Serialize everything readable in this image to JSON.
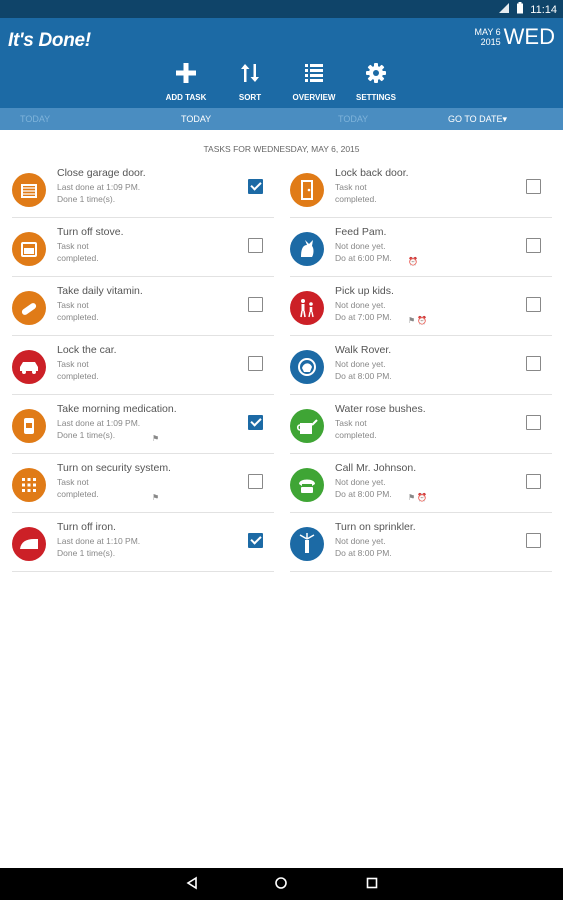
{
  "status_bar": {
    "time": "11:14"
  },
  "app": {
    "title": "It's Done!",
    "date_month_day": "MAY 6",
    "date_year": "2015",
    "weekday": "WED",
    "colors": {
      "primary": "#1c6aa5",
      "status": "#0f4469",
      "tabbar": "#4a8dc1"
    }
  },
  "toolbar": {
    "add_task": "ADD TASK",
    "sort": "SORT",
    "overview": "OVERVIEW",
    "settings": "SETTINGS"
  },
  "tabs": {
    "prev": "TODAY",
    "current": "TODAY",
    "next": "TODAY",
    "go_to_date": "GO TO DATE▾"
  },
  "subtitle": "TASKS FOR WEDNESDAY, MAY 6, 2015",
  "tasks_left": [
    {
      "title": "Close garage door.",
      "line1": "Last done at 1:09 PM.",
      "line2": "Done 1 time(s).",
      "checked": true,
      "icon": "garage-icon",
      "color": "#e07b17",
      "badge": ""
    },
    {
      "title": "Turn off stove.",
      "line1": "Task not",
      "line2": "completed.",
      "checked": false,
      "icon": "stove-icon",
      "color": "#e07b17",
      "badge": ""
    },
    {
      "title": "Take daily vitamin.",
      "line1": "Task not",
      "line2": "completed.",
      "checked": false,
      "icon": "vitamin-icon",
      "color": "#e07b17",
      "badge": ""
    },
    {
      "title": "Lock the car.",
      "line1": "Task not",
      "line2": "completed.",
      "checked": false,
      "icon": "car-icon",
      "color": "#cc2027",
      "badge": ""
    },
    {
      "title": "Take morning medication.",
      "line1": "Last done at 1:09 PM.",
      "line2": "Done 1 time(s).",
      "checked": true,
      "icon": "medication-icon",
      "color": "#e07b17",
      "badge": "⚑"
    },
    {
      "title": "Turn on security system.",
      "line1": "Task not",
      "line2": "completed.",
      "checked": false,
      "icon": "keypad-icon",
      "color": "#e07b17",
      "badge": "⚑"
    },
    {
      "title": "Turn off iron.",
      "line1": "Last done at 1:10 PM.",
      "line2": "Done 1 time(s).",
      "checked": true,
      "icon": "iron-icon",
      "color": "#cc2027",
      "badge": ""
    }
  ],
  "tasks_right": [
    {
      "title": "Lock back door.",
      "line1": "Task not",
      "line2": "completed.",
      "checked": false,
      "icon": "door-icon",
      "color": "#e07b17",
      "badge": ""
    },
    {
      "title": "Feed Pam.",
      "line1": "Not done yet.",
      "line2": "Do at 6:00 PM.",
      "checked": false,
      "icon": "cat-icon",
      "color": "#1c6aa5",
      "badge": "⏰"
    },
    {
      "title": "Pick up kids.",
      "line1": "Not done yet.",
      "line2": "Do at 7:00 PM.",
      "checked": false,
      "icon": "kids-icon",
      "color": "#cc2027",
      "badge": "⚑ ⏰"
    },
    {
      "title": "Walk Rover.",
      "line1": "Not done yet.",
      "line2": "Do at 8:00 PM.",
      "checked": false,
      "icon": "dog-icon",
      "color": "#1c6aa5",
      "badge": ""
    },
    {
      "title": "Water rose bushes.",
      "line1": "Task not",
      "line2": "completed.",
      "checked": false,
      "icon": "watering-can-icon",
      "color": "#3fa535",
      "badge": ""
    },
    {
      "title": "Call Mr. Johnson.",
      "line1": "Not done yet.",
      "line2": "Do at 8:00 PM.",
      "checked": false,
      "icon": "phone-icon",
      "color": "#3fa535",
      "badge": "⚑ ⏰"
    },
    {
      "title": "Turn on sprinkler.",
      "line1": "Not done yet.",
      "line2": "Do at 8:00 PM.",
      "checked": false,
      "icon": "sprinkler-icon",
      "color": "#1c6aa5",
      "badge": ""
    }
  ]
}
